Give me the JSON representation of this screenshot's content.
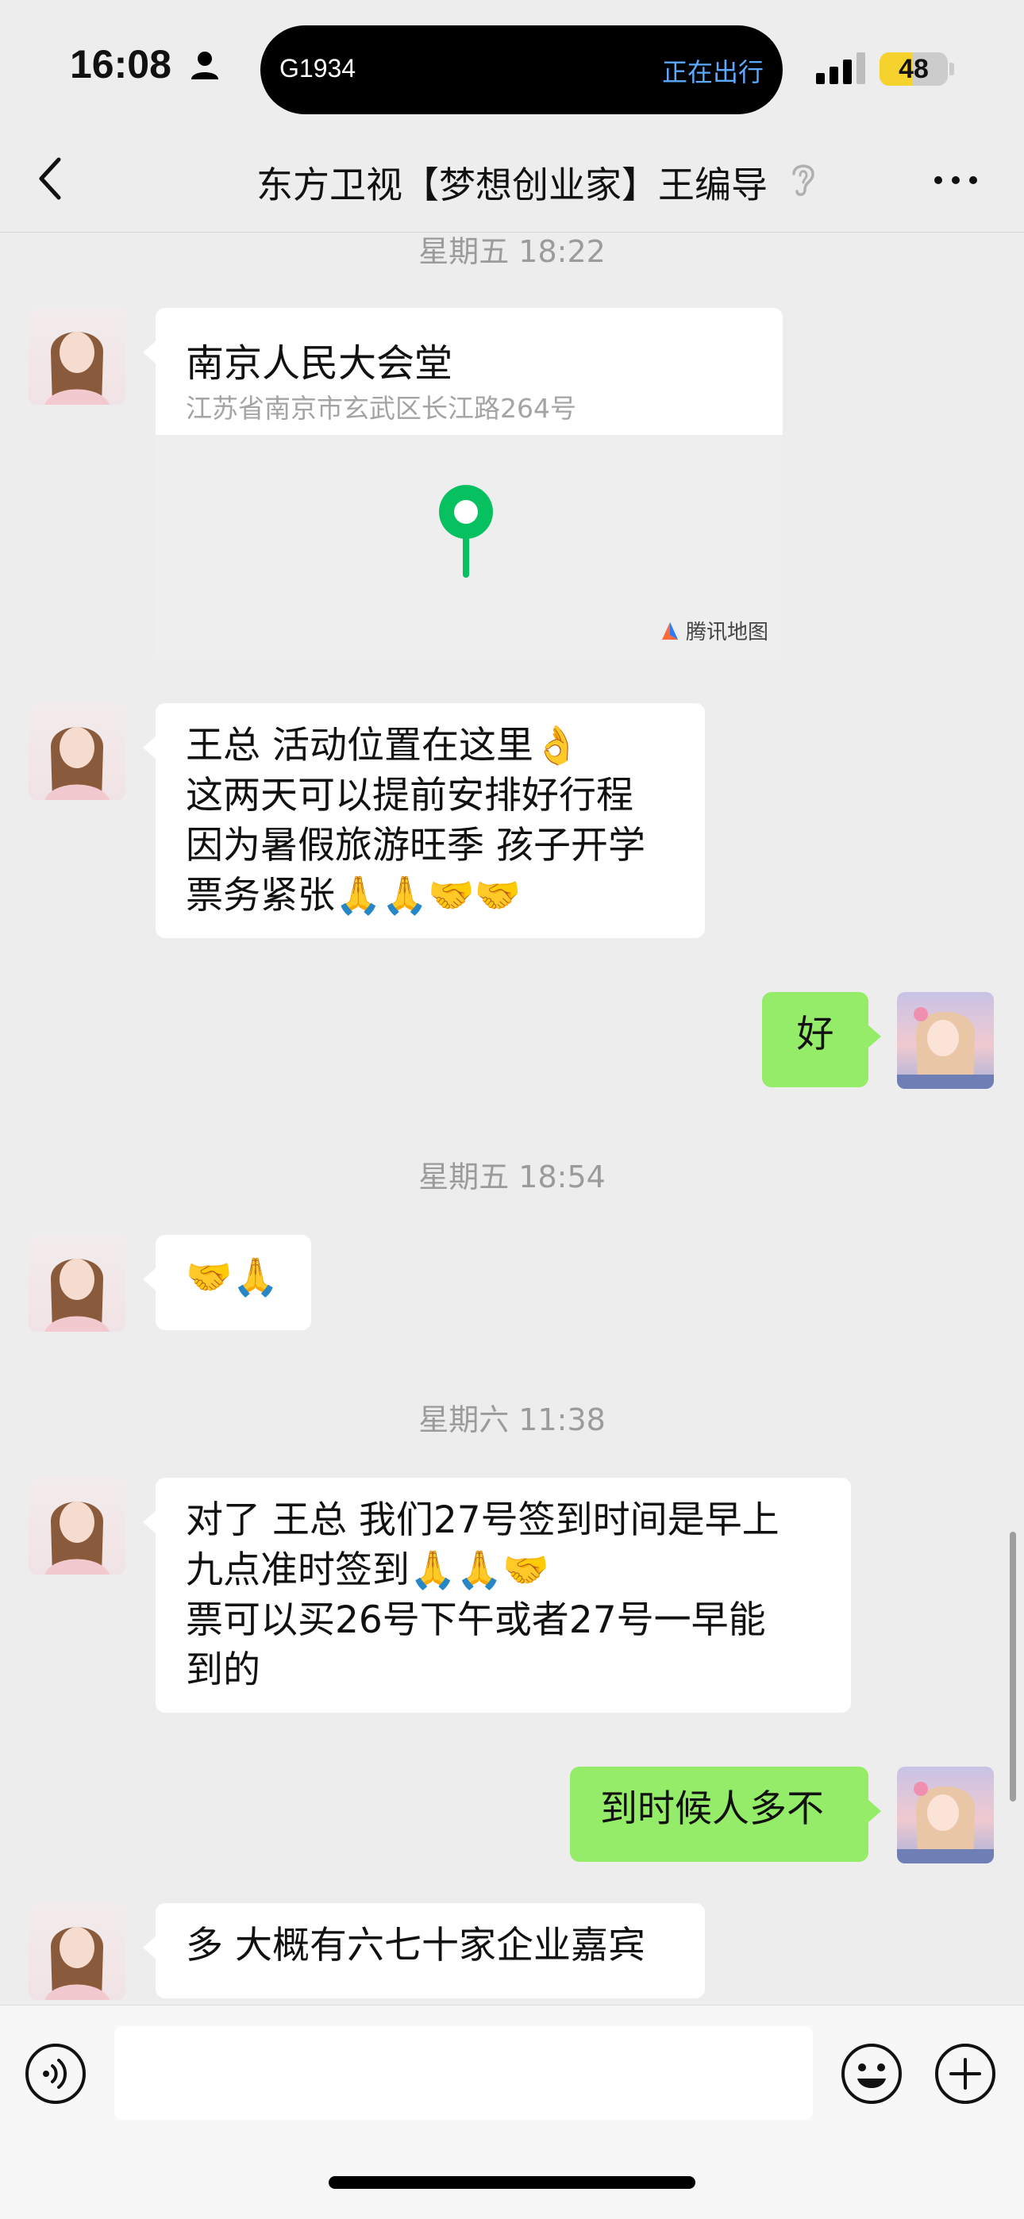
{
  "status_bar": {
    "time": "16:08",
    "live_activity_train": "G1934",
    "live_activity_status": "正在出行",
    "battery_level": "48",
    "battery_fraction": 0.48
  },
  "nav": {
    "title": "东方卫视【梦想创业家】王编导"
  },
  "timestamps": {
    "t1": "星期五 18:22",
    "t2": "星期五 18:54",
    "t3": "星期六 11:38"
  },
  "location_card": {
    "name": "南京人民大会堂",
    "address": "江苏省南京市玄武区长江路264号",
    "map_brand": "腾讯地图",
    "pin_color": "#07c160"
  },
  "messages": {
    "m1": [
      "王总 活动位置在这里👌",
      "这两天可以提前安排好行程",
      "因为暑假旅游旺季 孩子开学",
      "票务紧张🙏🙏🤝🤝"
    ],
    "m2": "好",
    "m3": "🤝🙏",
    "m4": [
      "对了 王总 我们27号签到时间是早上",
      "九点准时签到🙏🙏🤝",
      "票可以买26号下午或者27号一早能",
      "到的"
    ],
    "m5": "到时候人多不",
    "m6": "多 大概有六七十家企业嘉宾"
  },
  "colors": {
    "outgoing_bubble": "#95ec69",
    "incoming_bubble": "#ffffff",
    "chat_background": "#ededed"
  },
  "icons": [
    "person-icon",
    "signal-icon",
    "back-icon",
    "ear-icon",
    "more-icon",
    "map-pin-icon",
    "voice-icon",
    "emoji-icon",
    "plus-icon"
  ]
}
